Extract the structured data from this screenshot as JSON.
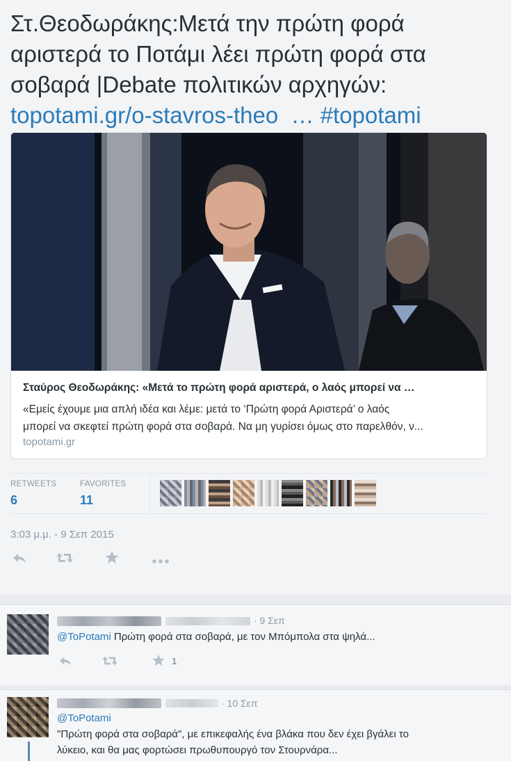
{
  "tweet": {
    "text_line1": "Στ.Θεοδωράκης:Μετά την πρώτη φορά",
    "text_line2": "αριστερά το Ποτάμι λέει πρώτη φορά στα",
    "text_line3": "σοβαρά |Debate πολιτικών αρχηγών:",
    "link": "topotami.gr/o-stavros-theo",
    "ellipsis": "…",
    "hashtag": "#topotami"
  },
  "card": {
    "title": "Σταύρος Θεοδωράκης: «Μετά το πρώτη φορά αριστερά, ο λαός μπορεί να …",
    "desc_line1": "«Εμείς έχουμε μια απλή ιδέα και λέμε: μετά το ‘Πρώτη φορά Αριστερά’ ο λαός",
    "desc_line2": "μπορεί να σκεφτεί πρώτη φορά στα σοβαρά. Να μη γυρίσει όμως στο παρελθόν, ν...",
    "domain": "topotami.gr"
  },
  "stats": {
    "retweets_label": "RETWEETS",
    "retweets_value": "6",
    "favorites_label": "FAVORITES",
    "favorites_value": "11"
  },
  "timestamp": "3:03 μ.μ. - 9 Σεπ 2015",
  "actions": {
    "reply_icon": "reply-icon",
    "retweet_icon": "retweet-icon",
    "favorite_icon": "star-icon",
    "more_icon": "more-icon"
  },
  "replies": [
    {
      "time": "· 9 Σεπ",
      "mention": "@ToPotami",
      "text": " Πρώτη φορά στα σοβαρά, με τον Μπόμπολα στα ψηλά...",
      "favorites": "1"
    },
    {
      "time": "· 10 Σεπ",
      "mention": "@ToPotami",
      "text_line1": "\"Πρώτη φορά στα σοβαρά\", με επικεφαλής ένα βλάκα που δεν έχει βγάλει το",
      "text_line2": "λύκειο, και θα μας φορτώσει πρωθυπουργό τον Στουρνάρα..."
    }
  ],
  "colors": {
    "link": "#2b7bb9",
    "muted": "#8899a6",
    "text": "#292f33"
  }
}
